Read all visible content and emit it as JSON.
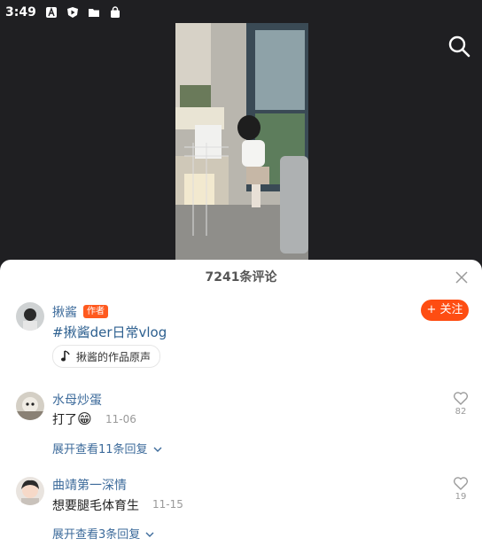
{
  "status_bar": {
    "time": "3:49"
  },
  "video": {
    "search_icon": "search-icon"
  },
  "comments_sheet": {
    "title": "7241条评论",
    "author_post": {
      "name": "揪酱",
      "badge": "作者",
      "follow_label": "+ 关注",
      "hashtag": "#揪酱der日常vlog",
      "music": "揪酱的作品原声"
    },
    "comments": [
      {
        "name": "水母炒蛋",
        "text": "打了",
        "emoji": "😁",
        "time": "11-06",
        "likes": "82",
        "expand": "展开查看11条回复"
      },
      {
        "name": "曲靖第一深情",
        "text": "想要腿毛体育生",
        "time": "11-15",
        "likes": "19",
        "expand": "展开查看3条回复"
      }
    ]
  },
  "colors": {
    "accent": "#fe4d12",
    "link": "#3d6b9b"
  }
}
